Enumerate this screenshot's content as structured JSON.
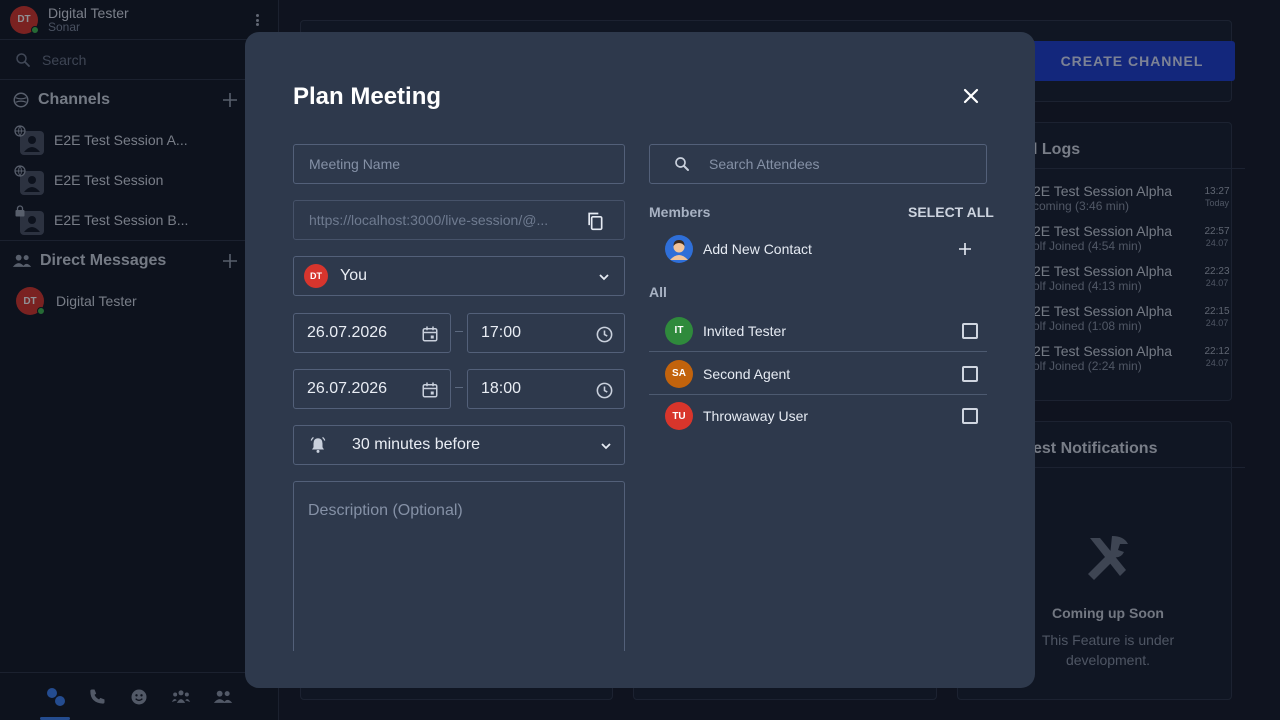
{
  "user": {
    "initials": "DT",
    "name": "Digital Tester",
    "workspace": "Sonar"
  },
  "sidebar": {
    "search_placeholder": "Search",
    "channels_title": "Channels",
    "channels": [
      {
        "name": "E2E Test Session A...",
        "badge": "globe"
      },
      {
        "name": "E2E Test Session",
        "badge": "globe"
      },
      {
        "name": "E2E Test Session B...",
        "badge": "lock"
      }
    ],
    "dm_title": "Direct Messages",
    "dms": [
      {
        "initials": "DT",
        "name": "Digital Tester"
      }
    ]
  },
  "main": {
    "create_channel": "CREATE CHANNEL",
    "logs_title": "l Logs",
    "logs": [
      {
        "title": "2E Test Session Alpha",
        "sub": "coming (3:46 min)",
        "time": "13:27",
        "date": "Today"
      },
      {
        "title": "2E Test Session Alpha",
        "sub": "olf Joined (4:54 min)",
        "time": "22:57",
        "date": "24.07"
      },
      {
        "title": "2E Test Session Alpha",
        "sub": "olf Joined (4:13 min)",
        "time": "22:23",
        "date": "24.07"
      },
      {
        "title": "2E Test Session Alpha",
        "sub": "olf Joined (1:08 min)",
        "time": "22:15",
        "date": "24.07"
      },
      {
        "title": "2E Test Session Alpha",
        "sub": "olf Joined (2:24 min)",
        "time": "22:12",
        "date": "24.07"
      }
    ],
    "notifications_title": "est Notifications",
    "coming_soon": "Coming up Soon",
    "coming_soon_sub": "This Feature is under development."
  },
  "modal": {
    "title": "Plan Meeting",
    "meeting_name_placeholder": "Meeting Name",
    "link": "https://localhost:3000/live-session/@...",
    "host": {
      "initials": "DT",
      "name": "You"
    },
    "start_date": "26.07.2026",
    "start_time": "17:00",
    "end_date": "26.07.2026",
    "end_time": "18:00",
    "reminder": "30 minutes before",
    "description_placeholder": "Description (Optional)",
    "search_placeholder": "Search Attendees",
    "members_label": "Members",
    "select_all": "SELECT ALL",
    "add_contact": "Add New Contact",
    "all_label": "All",
    "attendees": [
      {
        "initials": "IT",
        "name": "Invited Tester",
        "color": "#2f8a3c",
        "checked": false
      },
      {
        "initials": "SA",
        "name": "Second Agent",
        "color": "#c2630c",
        "checked": false
      },
      {
        "initials": "TU",
        "name": "Throwaway User",
        "color": "#d8352b",
        "checked": false
      }
    ]
  }
}
